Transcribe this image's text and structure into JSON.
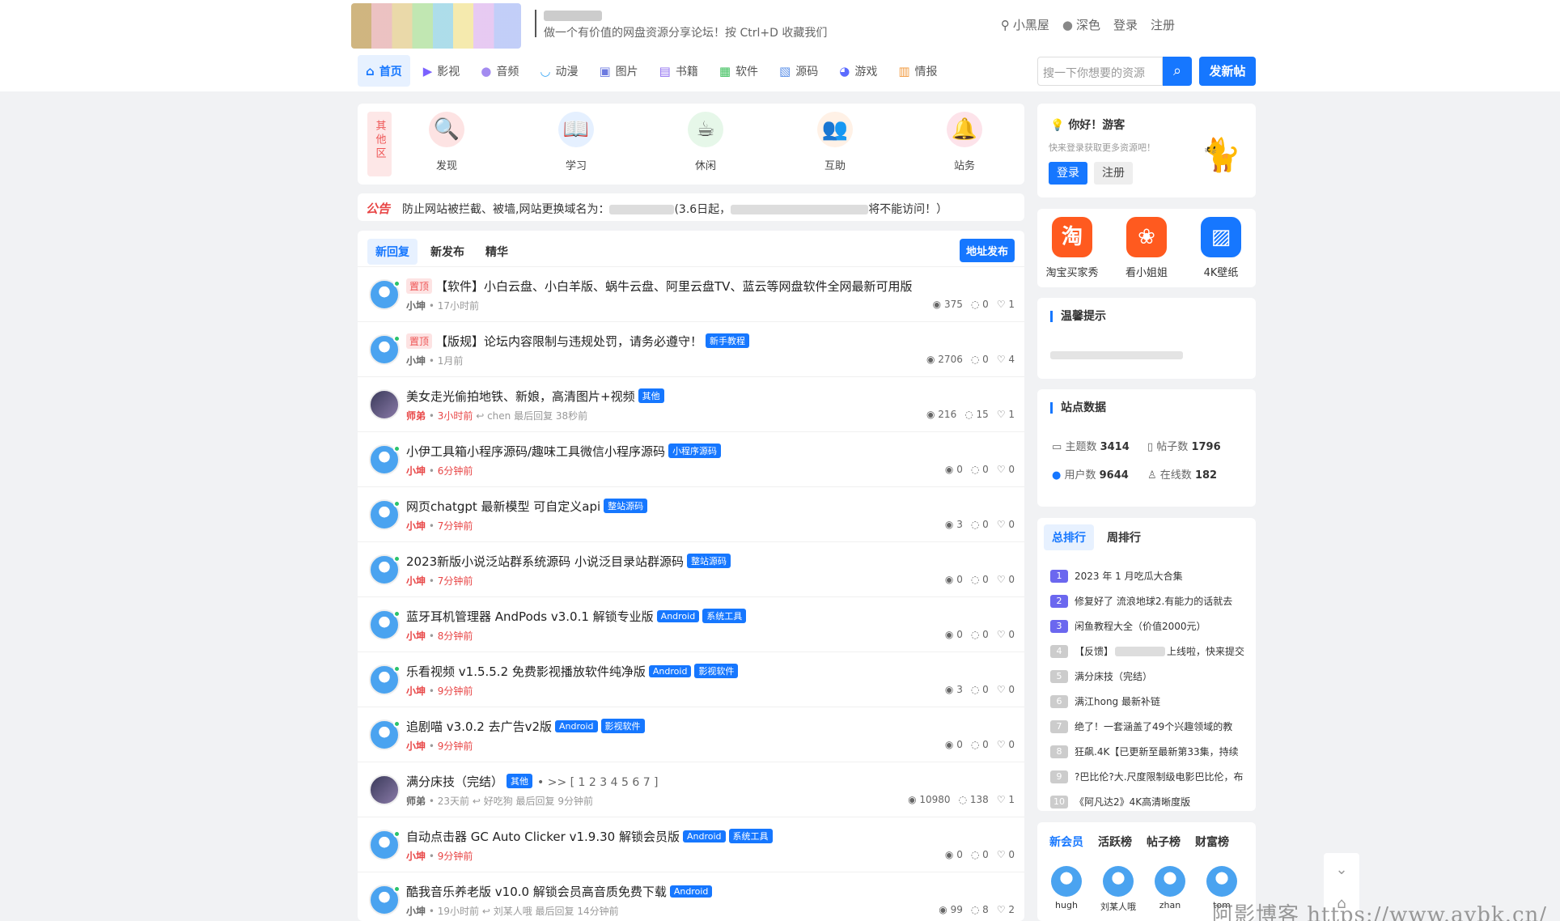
{
  "header": {
    "slogan": "做一个有价值的网盘资源分享论坛！按 Ctrl+D 收藏我们",
    "links": {
      "house": "小黑屋",
      "dark": "深色",
      "login": "登录",
      "register": "注册"
    }
  },
  "nav": [
    {
      "label": "首页",
      "icon": "⌂",
      "color": "#1677ff",
      "active": true
    },
    {
      "label": "影视",
      "icon": "▶",
      "color": "#7b61ff"
    },
    {
      "label": "音频",
      "icon": "●",
      "color": "#a38bf0"
    },
    {
      "label": "动漫",
      "icon": "◡",
      "color": "#3fa9f5"
    },
    {
      "label": "图片",
      "icon": "▣",
      "color": "#6c7ae0"
    },
    {
      "label": "书籍",
      "icon": "▤",
      "color": "#8e6cf0"
    },
    {
      "label": "软件",
      "icon": "▦",
      "color": "#3cbf5c"
    },
    {
      "label": "源码",
      "icon": "▧",
      "color": "#5a8fe8"
    },
    {
      "label": "游戏",
      "icon": "◕",
      "color": "#5b6bff"
    },
    {
      "label": "情报",
      "icon": "▥",
      "color": "#f29a3e"
    }
  ],
  "search": {
    "placeholder": "搜一下你想要的资源",
    "post_label": "发新帖"
  },
  "categories": {
    "tag": "其他区",
    "items": [
      {
        "label": "发现",
        "icon": "🔍",
        "bg": "#fde3e3"
      },
      {
        "label": "学习",
        "icon": "📖",
        "bg": "#e5f0ff"
      },
      {
        "label": "休闲",
        "icon": "☕",
        "bg": "#e6f7e9"
      },
      {
        "label": "互助",
        "icon": "👥",
        "bg": "#fff1e6"
      },
      {
        "label": "站务",
        "icon": "🔔",
        "bg": "#fde3ea"
      }
    ]
  },
  "notice": {
    "tag": "公告",
    "text_before": "防止网站被拦截、被墙,网站更换域名为：",
    "text_mid": "(3.6日起，",
    "text_after": "将不能访问！）"
  },
  "list": {
    "tabs": [
      "新回复",
      "新发布",
      "精华"
    ],
    "addr_button": "地址发布",
    "threads": [
      {
        "pin": "置顶",
        "title": "【软件】小白云盘、小白羊版、蜗牛云盘、阿里云盘TV、蓝云等网盘软件全网最新可用版",
        "tags": [],
        "author": "小坤",
        "time": "17小时前",
        "views": "375",
        "replies": "0",
        "likes": "1",
        "avatar": "blue"
      },
      {
        "pin": "置顶",
        "title": "【版规】论坛内容限制与违规处罚，请务必遵守！",
        "tags": [
          "新手教程"
        ],
        "author": "小坤",
        "time": "1月前",
        "views": "2706",
        "replies": "0",
        "likes": "4",
        "avatar": "blue"
      },
      {
        "title": "美女走光偷拍地铁、新娘，高清图片+视频",
        "tags": [
          "其他"
        ],
        "author": "师弟",
        "time": "3小时前",
        "last": "chen",
        "lasttime": "最后回复 38秒前",
        "views": "216",
        "replies": "15",
        "likes": "1",
        "avatar": "girl",
        "red": true
      },
      {
        "title": "小伊工具箱小程序源码/趣味工具微信小程序源码",
        "tags": [
          "小程序源码"
        ],
        "author": "小坤",
        "time": "6分钟前",
        "views": "0",
        "replies": "0",
        "likes": "0",
        "avatar": "blue",
        "red": true
      },
      {
        "title": "网页chatgpt 最新模型 可自定义api",
        "tags": [
          "整站源码"
        ],
        "author": "小坤",
        "time": "7分钟前",
        "views": "3",
        "replies": "0",
        "likes": "0",
        "avatar": "blue",
        "red": true
      },
      {
        "title": "2023新版小说泛站群系统源码 小说泛目录站群源码",
        "tags": [
          "整站源码"
        ],
        "author": "小坤",
        "time": "7分钟前",
        "views": "0",
        "replies": "0",
        "likes": "0",
        "avatar": "blue",
        "red": true
      },
      {
        "title": "蓝牙耳机管理器 AndPods v3.0.1 解锁专业版",
        "tags": [
          "Android",
          "系统工具"
        ],
        "author": "小坤",
        "time": "8分钟前",
        "views": "0",
        "replies": "0",
        "likes": "0",
        "avatar": "blue",
        "red": true
      },
      {
        "title": "乐看视频 v1.5.5.2 免费影视播放软件纯净版",
        "tags": [
          "Android",
          "影视软件"
        ],
        "author": "小坤",
        "time": "9分钟前",
        "views": "3",
        "replies": "0",
        "likes": "0",
        "avatar": "blue",
        "red": true
      },
      {
        "title": "追剧喵 v3.0.2 去广告v2版",
        "tags": [
          "Android",
          "影视软件"
        ],
        "author": "小坤",
        "time": "9分钟前",
        "views": "0",
        "replies": "0",
        "likes": "0",
        "avatar": "blue",
        "red": true
      },
      {
        "title": "满分床技（完结）",
        "tags": [
          "其他"
        ],
        "pages": "• >> [ 1 2 3 4 5 6 7 ]",
        "author": "师弟",
        "time": "23天前",
        "last": "好吃狗",
        "lasttime": "最后回复 9分钟前",
        "views": "10980",
        "replies": "138",
        "likes": "1",
        "avatar": "girl"
      },
      {
        "title": "自动点击器 GC Auto Clicker v1.9.30 解锁会员版",
        "tags": [
          "Android",
          "系统工具"
        ],
        "author": "小坤",
        "time": "9分钟前",
        "views": "0",
        "replies": "0",
        "likes": "0",
        "avatar": "blue",
        "red": true
      },
      {
        "title": "酷我音乐养老版 v10.0 解锁会员高音质免费下载",
        "tags": [
          "Android"
        ],
        "author": "小坤",
        "time": "19小时前",
        "last": "刘某人哦",
        "lasttime": "最后回复 14分钟前",
        "views": "99",
        "replies": "8",
        "likes": "2",
        "avatar": "blue"
      }
    ]
  },
  "hello": {
    "title": "你好！游客",
    "sub": "快来登录获取更多资源吧！",
    "login": "登录",
    "register": "注册"
  },
  "apps": [
    {
      "label": "淘宝买家秀",
      "icon": "淘",
      "color": "#ff5a1f"
    },
    {
      "label": "看小姐姐",
      "icon": "❀",
      "color": "#ff5a1f"
    },
    {
      "label": "4K壁纸",
      "icon": "▨",
      "color": "#1677ff"
    }
  ],
  "tips": {
    "title": "温馨提示"
  },
  "stats": {
    "title": "站点数据",
    "topics_label": "主题数",
    "topics": "3414",
    "posts_label": "帖子数",
    "posts": "1796",
    "users_label": "用户数",
    "users": "9644",
    "online_label": "在线数",
    "online": "182"
  },
  "rank": {
    "tabs": [
      "总排行",
      "周排行"
    ],
    "items": [
      "2023 年 1 月吃瓜大合集",
      "修复好了 流浪地球2.有能力的话就去",
      "闲鱼教程大全（价值2000元）",
      "【反馈】",
      "满分床技（完结）",
      "满江hong 最新补链",
      "绝了！一套涵盖了49个兴趣领域的教",
      "狂飙.4K【已更新至最新第33集，持续",
      "?巴比伦?大.尺度限制级电影巴比伦，布",
      "《阿凡达2》4K高清晰度版"
    ],
    "item4_suffix": "上线啦，快来提交"
  },
  "members": {
    "tabs": [
      "新会员",
      "活跃榜",
      "帖子榜",
      "财富榜"
    ],
    "items": [
      "hugh",
      "刘某人哦",
      "zhan",
      "tom"
    ]
  },
  "watermark": "阿影博客 https://www.aybk.cn/"
}
